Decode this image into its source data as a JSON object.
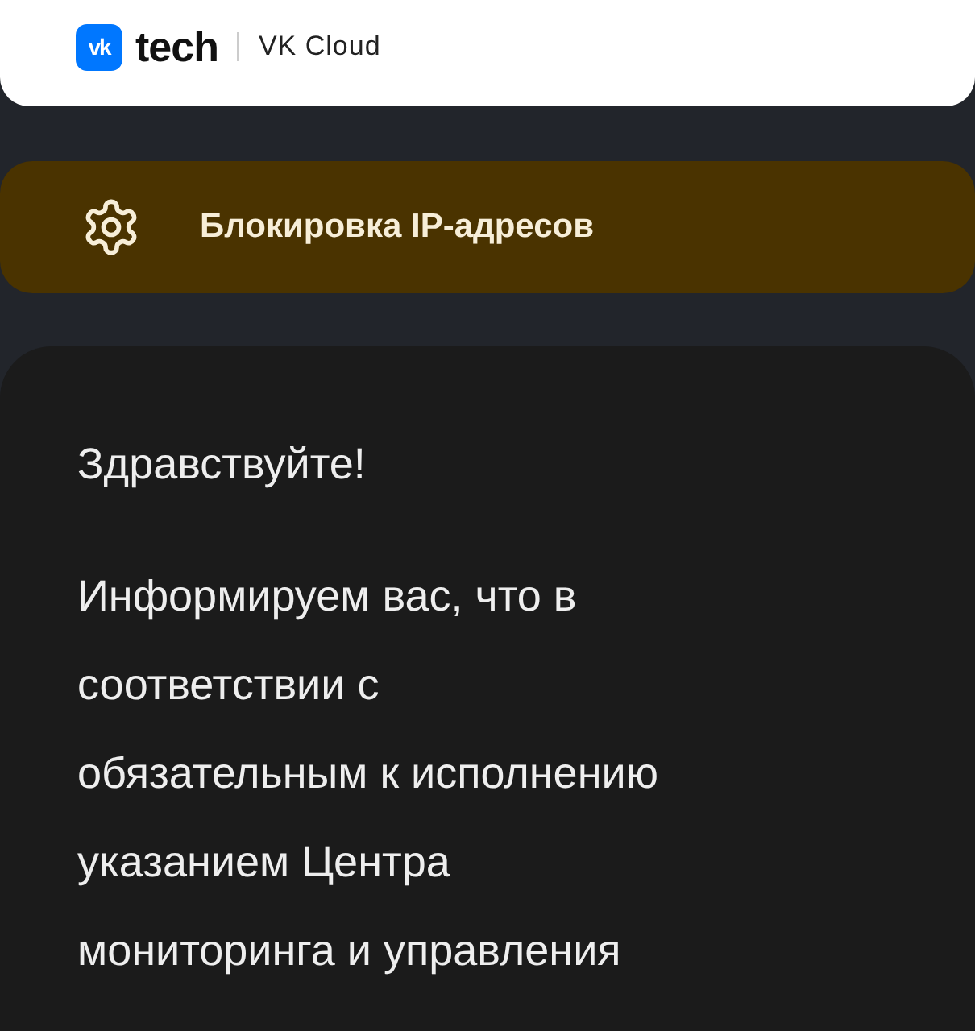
{
  "header": {
    "logo_mark": "vk",
    "brand": "tech",
    "product": "VK Cloud"
  },
  "banner": {
    "title": "Блокировка IP-адресов"
  },
  "message": {
    "greeting": "Здравствуйте!",
    "body": "Информируем вас, что в\nсоответствии с\nобязательным к исполнению\nуказанием Центра\nмониторинга и управления"
  }
}
